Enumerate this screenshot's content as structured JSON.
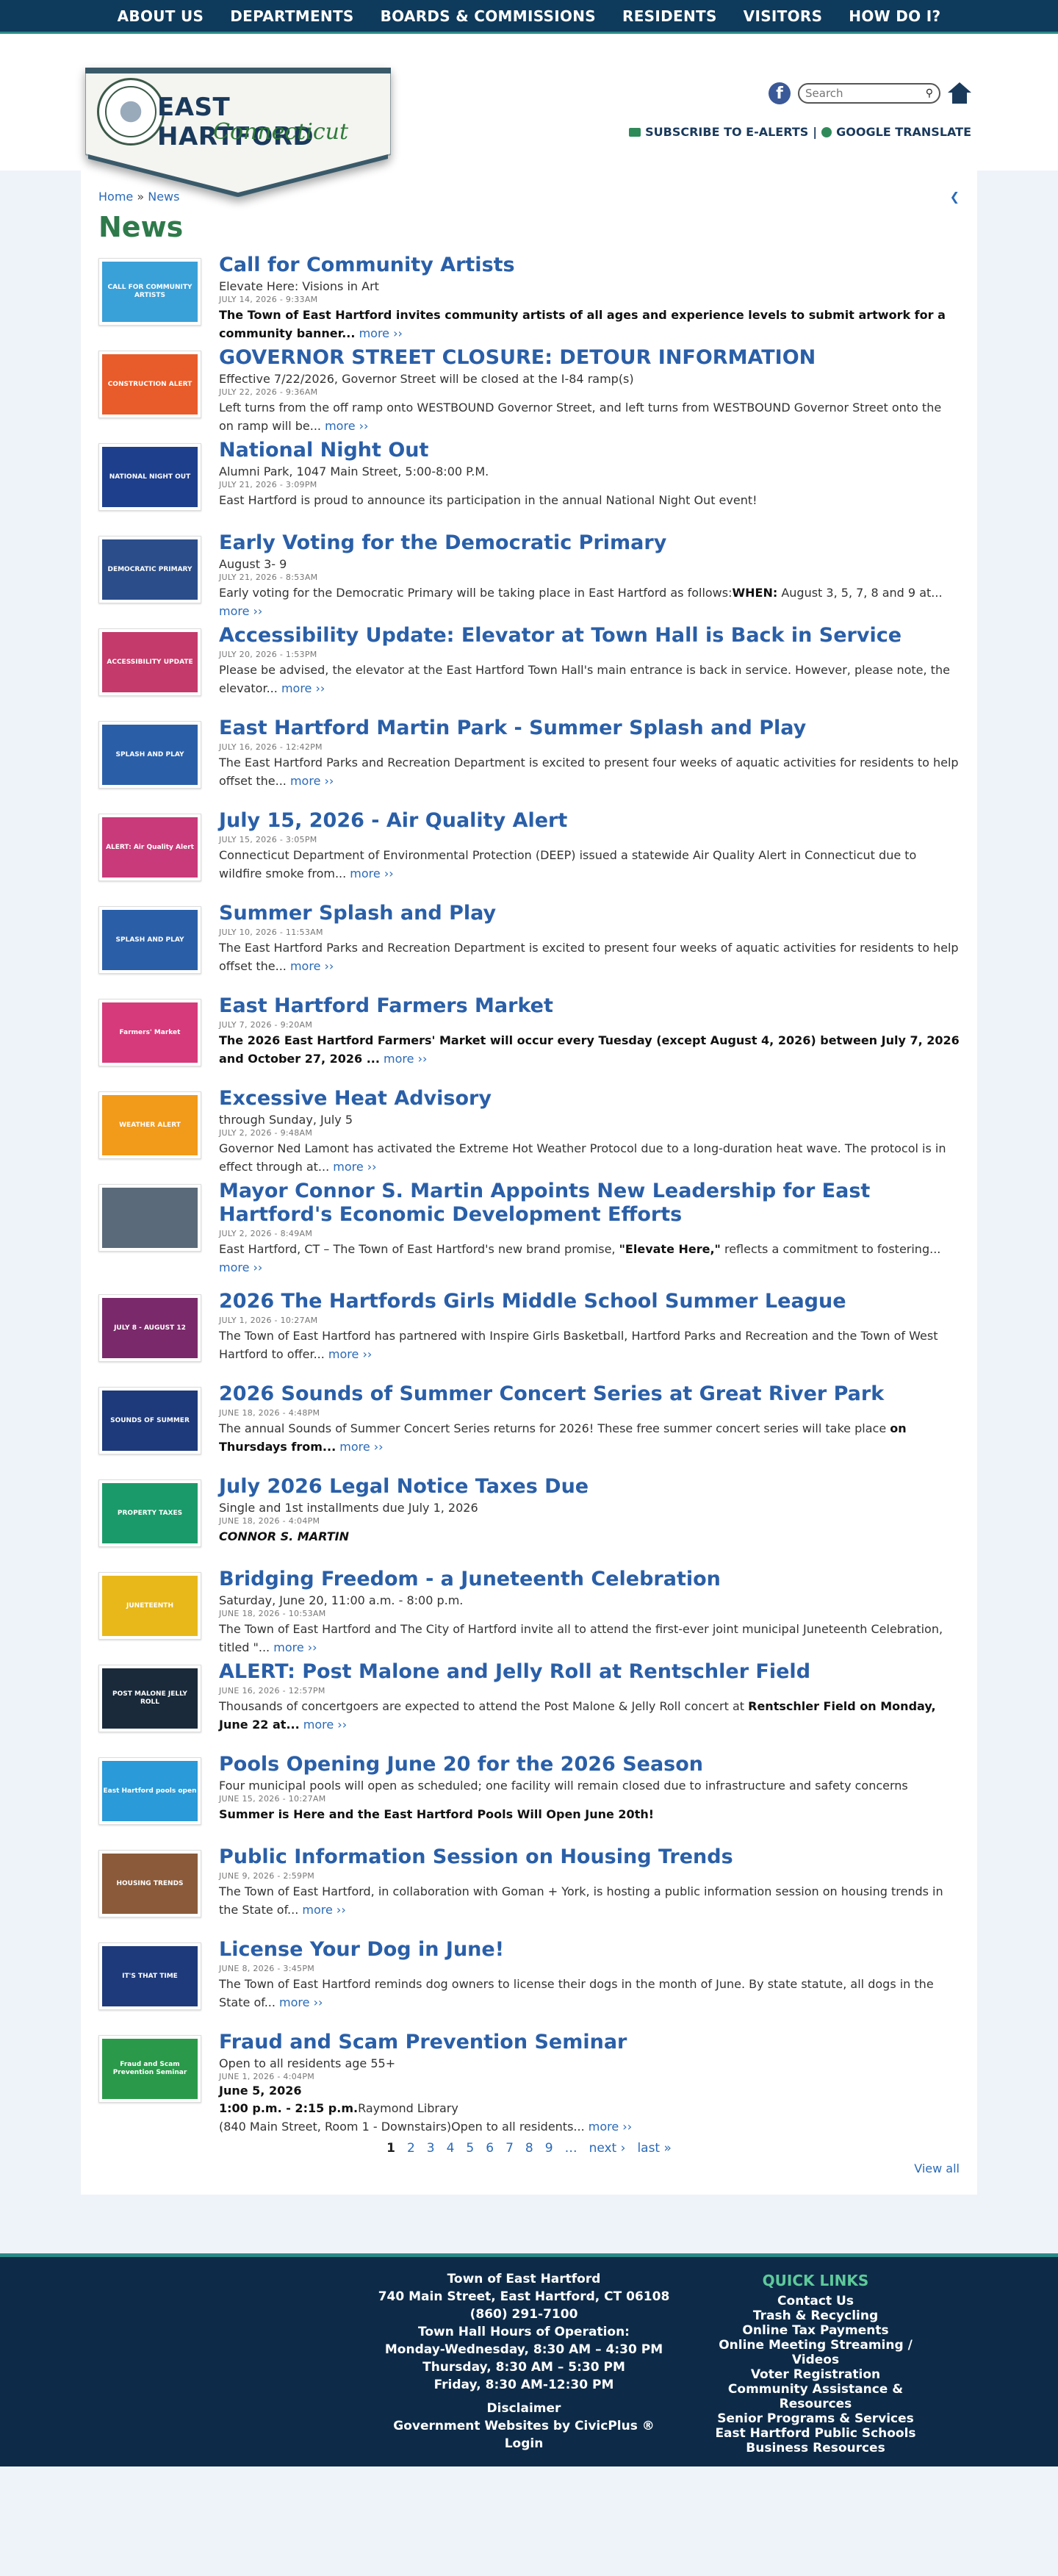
{
  "topnav": [
    "ABOUT US",
    "DEPARTMENTS",
    "BOARDS & COMMISSIONS",
    "RESIDENTS",
    "VISITORS",
    "HOW DO I?"
  ],
  "logo": {
    "title": "EAST HARTFORD",
    "subtitle": "Connecticut"
  },
  "search": {
    "placeholder": "Search"
  },
  "header_links": {
    "alerts": "SUBSCRIBE TO E-ALERTS",
    "separator": "|",
    "translate": "GOOGLE TRANSLATE"
  },
  "breadcrumb": {
    "home": "Home",
    "sep": "»",
    "current": "News"
  },
  "page_title": "News",
  "news": [
    {
      "title": "Call for Community Artists",
      "subtitle": "Elevate Here: Visions in Art",
      "date": "JULY 14, 2026 - 9:33AM",
      "summary": "",
      "bold": "The Town of East Hartford invites community artists of all ages and experience levels to submit artwork for a community banner...",
      "more": "more ››",
      "thumb_text": "CALL FOR COMMUNITY ARTISTS",
      "thumb_color": "#3aa0d8"
    },
    {
      "title": "GOVERNOR STREET CLOSURE: DETOUR INFORMATION",
      "subtitle": "Effective 7/22/2026, Governor Street will be closed at the I-84 ramp(s)",
      "date": "JULY 22, 2026 - 9:36AM",
      "summary": "Left turns from the off ramp onto WESTBOUND Governor Street, and left turns from WESTBOUND Governor Street onto the on ramp will be...",
      "more": "more ››",
      "thumb_text": "CONSTRUCTION ALERT",
      "thumb_color": "#e85b2a"
    },
    {
      "title": "National Night Out",
      "subtitle": "Alumni Park, 1047 Main Street, 5:00-8:00 P.M.",
      "date": "JULY 21, 2026 - 3:09PM",
      "summary": "East Hartford is proud to announce its participation in the annual National Night Out event!",
      "more": "",
      "thumb_text": "NATIONAL NIGHT OUT",
      "thumb_color": "#1e3f8c"
    },
    {
      "title": "Early Voting for the Democratic Primary",
      "subtitle": "August 3- 9",
      "date": "JULY 21, 2026 - 8:53AM",
      "summary": "Early voting for the Democratic Primary will be taking place in East Hartford as follows:",
      "bold_mid": "WHEN:",
      "summary_tail": " August 3, 5, 7, 8 and 9 at...",
      "more": "more ››",
      "thumb_text": "DEMOCRATIC PRIMARY",
      "thumb_color": "#2b4e8a"
    },
    {
      "title": "Accessibility Update: Elevator at Town Hall is Back in Service",
      "subtitle": "",
      "date": "JULY 20, 2026 - 1:53PM",
      "summary": "Please be advised, the elevator at the East Hartford Town Hall's main entrance is back in service. However, please note, the elevator...",
      "more": "more ››",
      "thumb_text": "ACCESSIBILITY UPDATE",
      "thumb_color": "#c43a6a"
    },
    {
      "title": "East Hartford Martin Park - Summer Splash and Play",
      "subtitle": "",
      "date": "JULY 16, 2026 - 12:42PM",
      "summary": "The East Hartford Parks and Recreation Department is excited to present four weeks of aquatic activities for residents to help offset the...",
      "more": "more ››",
      "thumb_text": "SPLASH AND PLAY",
      "thumb_color": "#2a5fa8"
    },
    {
      "title": "July 15, 2026 - Air Quality Alert",
      "subtitle": "",
      "date": "JULY 15, 2026 - 3:05PM",
      "summary": "Connecticut Department of Environmental Protection (DEEP) issued a statewide Air Quality Alert in Connecticut due to wildfire smoke from...",
      "more": "more ››",
      "thumb_text": "ALERT: Air Quality Alert",
      "thumb_color": "#c83a7a"
    },
    {
      "title": "Summer Splash and Play",
      "subtitle": "",
      "date": "JULY 10, 2026 - 11:53AM",
      "summary": "The East Hartford Parks and Recreation Department is excited to present four weeks of aquatic activities for residents to help offset the...",
      "more": "more ››",
      "thumb_text": "SPLASH AND PLAY",
      "thumb_color": "#2a5fa8"
    },
    {
      "title": "East Hartford Farmers Market",
      "subtitle": "",
      "date": "JULY 7, 2026 - 9:20AM",
      "summary": "",
      "bold": "The 2026 East Hartford Farmers' Market will occur every Tuesday (except August 4, 2026) between July 7, 2026 and October 27, 2026 ...",
      "more": "more ››",
      "thumb_text": "Farmers' Market",
      "thumb_color": "#d63a7a"
    },
    {
      "title": "Excessive Heat Advisory",
      "subtitle": "through Sunday, July 5",
      "date": "JULY 2, 2026 - 9:48AM",
      "summary": "Governor Ned Lamont has activated the Extreme Hot Weather Protocol due to a long-duration heat wave. The protocol is in effect through at...",
      "more": "more ››",
      "thumb_text": "WEATHER ALERT",
      "thumb_color": "#f29a1a"
    },
    {
      "title": "Mayor Connor S. Martin Appoints New Leadership for East Hartford's Economic Development Efforts",
      "subtitle": "",
      "date": "JULY 2, 2026 - 8:49AM",
      "summary": "East Hartford, CT – The Town of East Hartford's new brand promise, ",
      "bold_mid": "\"Elevate Here,\"",
      "summary_tail": " reflects a commitment to fostering...",
      "more": "more ››",
      "thumb_text": "",
      "thumb_color": "#5a6a7a"
    },
    {
      "title": "2026 The Hartfords Girls Middle School Summer League",
      "subtitle": "",
      "date": "JULY 1, 2026 - 10:27AM",
      "summary": "The Town of East Hartford has partnered with Inspire Girls Basketball, Hartford Parks and Recreation and the Town of West Hartford to offer...",
      "more": "more ››",
      "thumb_text": "JULY 8 - AUGUST 12",
      "thumb_color": "#7a2a6a"
    },
    {
      "title": "2026 Sounds of Summer Concert Series at Great River Park",
      "subtitle": "",
      "date": "JUNE 18, 2026 - 4:48PM",
      "summary": "The annual Sounds of Summer Concert Series returns for 2026! These free summer concert series will take place ",
      "bold_mid": "on Thursdays from...",
      "summary_tail": "",
      "more": "more ››",
      "thumb_text": "SOUNDS OF SUMMER",
      "thumb_color": "#1e3a7a"
    },
    {
      "title": "July 2026 Legal Notice Taxes Due",
      "subtitle": "Single and 1st installments due July 1, 2026",
      "date": "JUNE 18, 2026 - 4:04PM",
      "summary": "",
      "bold_italic": "CONNOR S. MARTIN",
      "more": "",
      "thumb_text": "PROPERTY TAXES",
      "thumb_color": "#1a9a6a"
    },
    {
      "title": "Bridging Freedom - a Juneteenth Celebration",
      "subtitle": "Saturday, June 20, 11:00 a.m. - 8:00 p.m.",
      "date": "JUNE 18, 2026 - 10:53AM",
      "summary": "The Town of East Hartford and The City of Hartford invite all to attend the first-ever joint municipal Juneteenth Celebration, titled \"...",
      "more": "more ››",
      "thumb_text": "JUNETEENTH",
      "thumb_color": "#e8b81a"
    },
    {
      "title": "ALERT: Post Malone and Jelly Roll at Rentschler Field",
      "subtitle": "",
      "date": "JUNE 16, 2026 - 12:57PM",
      "summary": "Thousands of concertgoers are expected to attend the Post Malone & Jelly Roll concert at ",
      "bold_mid": "Rentschler Field on Monday, June 22 at...",
      "summary_tail": "",
      "more": "more ››",
      "thumb_text": "POST MALONE JELLY ROLL",
      "thumb_color": "#1a2a3a"
    },
    {
      "title": "Pools Opening June 20 for the 2026 Season",
      "subtitle": "Four municipal pools will open as scheduled; one facility will remain closed due to infrastructure and safety concerns",
      "date": "JUNE 15, 2026 - 10:27AM",
      "summary": "",
      "bold": "Summer is Here and the East Hartford Pools Will Open June 20th!",
      "more": "",
      "thumb_text": "East Hartford pools open",
      "thumb_color": "#2a9ad8"
    },
    {
      "title": "Public Information Session on Housing Trends",
      "subtitle": "",
      "date": "JUNE 9, 2026 - 2:59PM",
      "summary": "The Town of East Hartford, in collaboration with Goman + York, is hosting a public information session on housing trends in the State of...",
      "more": "more ››",
      "thumb_text": "HOUSING TRENDS",
      "thumb_color": "#8a5a3a"
    },
    {
      "title": "License Your Dog in June!",
      "subtitle": "",
      "date": "JUNE 8, 2026 - 3:45PM",
      "summary": "The Town of East Hartford reminds dog owners to license their dogs in the month of June. By state statute, all dogs in the State of...",
      "more": "more ››",
      "thumb_text": "IT'S THAT TIME",
      "thumb_color": "#1e3a7a"
    },
    {
      "title": "Fraud and Scam Prevention Seminar",
      "subtitle": "Open to all residents age 55+",
      "date": "JUNE 1, 2026 - 4:04PM",
      "extra_bold_1": "June 5, 2026",
      "extra_bold_2": "1:00 p.m. - 2:15 p.m.",
      "extra_tail": "Raymond Library",
      "summary": "(840 Main Street, Room 1 - Downstairs)Open to all residents...",
      "more": "more ››",
      "thumb_text": "Fraud and Scam Prevention Seminar",
      "thumb_color": "#2a9a4a"
    }
  ],
  "pager": {
    "pages": [
      "1",
      "2",
      "3",
      "4",
      "5",
      "6",
      "7",
      "8",
      "9"
    ],
    "ellipsis": "…",
    "next": "next ›",
    "last": "last »"
  },
  "view_all": "View all",
  "footer": {
    "org": "Town of East Hartford",
    "address": "740 Main Street, East Hartford, CT 06108  (860) 291-7100",
    "hours_title": "Town Hall Hours of Operation:",
    "hours_1": "Monday-Wednesday, 8:30 AM – 4:30 PM",
    "hours_2": "Thursday, 8:30 AM – 5:30 PM",
    "hours_3": "Friday, 8:30 AM-12:30 PM",
    "disclaimer": "Disclaimer",
    "credit": "Government Websites by CivicPlus ®",
    "login": "Login",
    "quick_links_title": "QUICK LINKS",
    "quick_links": [
      "Contact Us",
      "Trash & Recycling",
      "Online Tax Payments",
      "Online Meeting Streaming / Videos",
      "Voter Registration",
      "Community Assistance & Resources",
      "Senior Programs & Services",
      "East Hartford Public Schools",
      "Business Resources"
    ]
  },
  "colors": {
    "nav_bg": "#0e3a5c",
    "accent": "#2a8a88",
    "title_green": "#2e7a4a",
    "link_blue": "#2a5fa8",
    "footer_bg": "#0d2b48",
    "quick_links": "#5ec99a"
  }
}
